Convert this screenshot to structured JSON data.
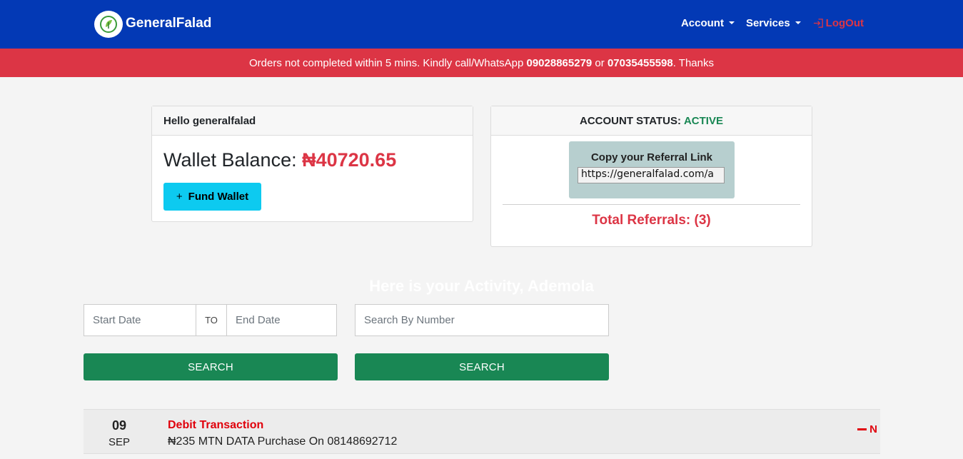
{
  "navbar": {
    "brand": "GeneralFalad",
    "account": "Account",
    "services": "Services",
    "logout": "LogOut"
  },
  "notice": {
    "text1": "Orders not completed within 5 mins. Kindly call/WhatsApp ",
    "phone1": "09028865279",
    "text2": " or ",
    "phone2": "07035455598",
    "text3": ". Thanks"
  },
  "wallet_card": {
    "greeting": "Hello generalfalad",
    "balance_label": "Wallet Balance: ",
    "balance_amount": "₦40720.65",
    "fund_button_icon": "+",
    "fund_button": "Fund Wallet"
  },
  "status_card": {
    "status_label": "ACCOUNT STATUS:",
    "status_value": "ACTIVE",
    "referral_title": "Copy your Referral Link",
    "referral_link": "https://generalfalad.com/a",
    "total_referrals": "Total Referrals: (3)"
  },
  "activity": {
    "title": "Here is your Activity, Ademola",
    "start_placeholder": "Start Date",
    "to_label": "TO",
    "end_placeholder": "End Date",
    "number_placeholder": "Search By Number",
    "search_button_1": "SEARCH",
    "search_button_2": "SEARCH"
  },
  "transactions": [
    {
      "day": "09",
      "month": "SEP",
      "type": "Debit Transaction",
      "description": "₦235 MTN DATA Purchase On 08148692712",
      "amount": "N"
    }
  ],
  "colors": {
    "navbar": "#0339b5",
    "notice": "#dc3545",
    "success": "#198754",
    "info": "#0dcaf0",
    "danger": "#e0000b"
  }
}
